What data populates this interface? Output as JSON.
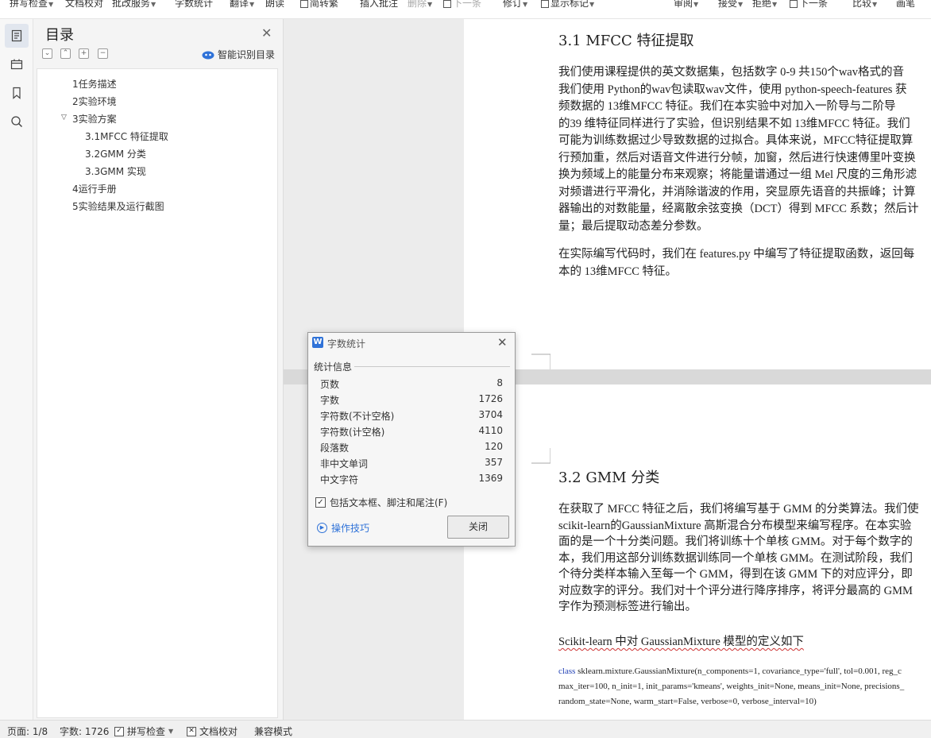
{
  "toolbar": {
    "items": [
      {
        "label": "拼写检查",
        "caret": true,
        "disabled": false,
        "icon": false
      },
      {
        "label": "文档校对",
        "caret": false,
        "disabled": false,
        "icon": false
      },
      {
        "label": "批改服务",
        "caret": true,
        "disabled": false,
        "icon": false
      },
      {
        "label": "字数统计",
        "caret": false,
        "disabled": false,
        "icon": false
      },
      {
        "label": "翻译",
        "caret": true,
        "disabled": false,
        "icon": false
      },
      {
        "label": "朗读",
        "caret": false,
        "disabled": false,
        "icon": false
      },
      {
        "label": "简转繁",
        "caret": false,
        "disabled": false,
        "icon": true
      },
      {
        "label": "插入批注",
        "caret": false,
        "disabled": false,
        "icon": false
      },
      {
        "label": "删除",
        "caret": true,
        "disabled": true,
        "icon": false
      },
      {
        "label": "下一条",
        "caret": false,
        "disabled": true,
        "icon": true
      },
      {
        "label": "修订",
        "caret": true,
        "disabled": false,
        "icon": false
      },
      {
        "label": "显示标记",
        "caret": true,
        "disabled": false,
        "icon": true
      },
      {
        "label": "审阅",
        "caret": true,
        "disabled": false,
        "icon": false
      },
      {
        "label": "接受",
        "caret": true,
        "disabled": false,
        "icon": false
      },
      {
        "label": "拒绝",
        "caret": true,
        "disabled": false,
        "icon": false
      },
      {
        "label": "下一条",
        "caret": false,
        "disabled": false,
        "icon": true
      },
      {
        "label": "比较",
        "caret": true,
        "disabled": false,
        "icon": false
      },
      {
        "label": "画笔",
        "caret": false,
        "disabled": false,
        "icon": false
      }
    ]
  },
  "iconbar": {
    "icons": [
      "outline-icon",
      "folder-tree-icon",
      "bookmark-icon",
      "search-icon"
    ]
  },
  "outline": {
    "title": "目录",
    "smart_label": "智能识别目录",
    "items": [
      {
        "label": "1任务描述",
        "level": 1,
        "expanded": null
      },
      {
        "label": "2实验环境",
        "level": 1,
        "expanded": null
      },
      {
        "label": "3实验方案",
        "level": 1,
        "expanded": true
      },
      {
        "label": "3.1MFCC 特征提取",
        "level": 2,
        "expanded": null
      },
      {
        "label": "3.2GMM 分类",
        "level": 2,
        "expanded": null
      },
      {
        "label": "3.3GMM 实现",
        "level": 2,
        "expanded": null
      },
      {
        "label": "4运行手册",
        "level": 1,
        "expanded": null
      },
      {
        "label": "5实验结果及运行截图",
        "level": 1,
        "expanded": null
      }
    ]
  },
  "document": {
    "page1": {
      "heading": "3.1 MFCC 特征提取",
      "para1": [
        "我们使用课程提供的英文数据集，包括数字 0-9 共150个wav格式的音",
        "我们使用 Python的wav包读取wav文件，使用 python-speech-features 获",
        "频数据的 13维MFCC 特征。我们在本实验中对加入一阶导与二阶导",
        "的39 维特征同样进行了实验，但识别结果不如 13维MFCC 特征。我们",
        "可能为训练数据过少导致数据的过拟合。具体来说，MFCC特征提取算",
        "行预加重，然后对语音文件进行分帧，加窗，然后进行快速傅里叶变换",
        "换为频域上的能量分布来观察；将能量谱通过一组 Mel 尺度的三角形滤",
        "对频谱进行平滑化，并消除谐波的作用，突显原先语音的共振峰；计算",
        "器输出的对数能量，经离散余弦变换（DCT）得到 MFCC 系数；然后计",
        "量；最后提取动态差分参数。"
      ],
      "para2": [
        "在实际编写代码时，我们在 features.py 中编写了特征提取函数，返回每",
        "本的 13维MFCC 特征。"
      ]
    },
    "page2": {
      "heading": "3.2 GMM 分类",
      "para1": [
        "在获取了 MFCC 特征之后，我们将编写基于 GMM 的分类算法。我们使",
        "scikit-learn的GaussianMixture 高斯混合分布模型来编写程序。在本实验",
        "面的是一个十分类问题。我们将训练十个单核 GMM。对于每个数字的",
        "本，我们用这部分训练数据训练同一个单核 GMM。在测试阶段，我们",
        "个待分类样本输入至每一个 GMM，得到在该 GMM 下的对应评分，即",
        "对应数字的评分。我们对十个评分进行降序排序，将评分最高的 GMM",
        "字作为预测标签进行输出。"
      ],
      "para2": "Scikit-learn 中对 GaussianMixture 模型的定义如下",
      "code": {
        "keyword": "class",
        "lines": [
          "sklearn.mixture.GaussianMixture(n_components=1, covariance_type='full', tol=0.001, reg_c",
          "max_iter=100, n_init=1, init_params='kmeans', weights_init=None, means_init=None, precisions_",
          "random_state=None, warm_start=False, verbose=0, verbose_interval=10)"
        ]
      }
    }
  },
  "dialog": {
    "title": "字数统计",
    "section": "统计信息",
    "rows": [
      {
        "label": "页数",
        "value": "8"
      },
      {
        "label": "字数",
        "value": "1726"
      },
      {
        "label": "字符数(不计空格)",
        "value": "3704"
      },
      {
        "label": "字符数(计空格)",
        "value": "4110"
      },
      {
        "label": "段落数",
        "value": "120"
      },
      {
        "label": "非中文单词",
        "value": "357"
      },
      {
        "label": "中文字符",
        "value": "1369"
      }
    ],
    "checkbox_label": "包括文本框、脚注和尾注(F)",
    "checkbox_checked": true,
    "tips_label": "操作技巧",
    "close_label": "关闭"
  },
  "statusbar": {
    "page": "页面: 1/8",
    "wordcount": "字数: 1726",
    "spellcheck": "拼写检查",
    "proofread": "文档校对",
    "compat": "兼容模式"
  },
  "colors": {
    "accent": "#2f72d8",
    "panel_bg": "#f4f4f4",
    "doc_bg": "#ececec",
    "page_sep": "#d9d9d9",
    "code_keyword": "#1f3fb4"
  }
}
